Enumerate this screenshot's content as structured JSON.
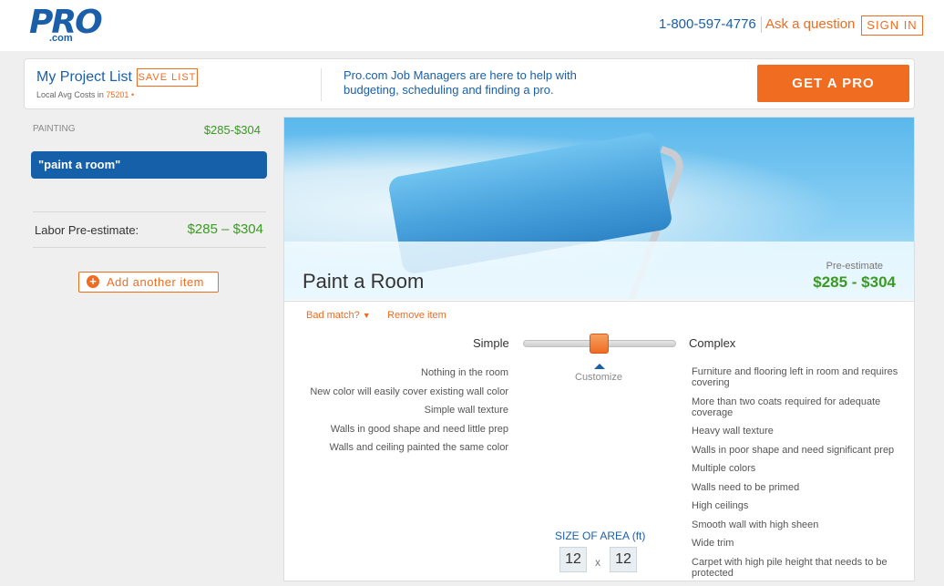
{
  "header": {
    "logo_text": "PRO",
    "logo_sub": ".com",
    "phone": "1-800-597-4776",
    "ask": "Ask a question",
    "signin": "SIGN IN"
  },
  "project_bar": {
    "title": "My Project List",
    "save_list": "SAVE LIST",
    "avg_label": "Local Avg Costs in",
    "zip": "75201",
    "message": "Pro.com Job Managers are here to help with budgeting, scheduling and finding a pro.",
    "get_pro": "GET A PRO"
  },
  "sidebar": {
    "category": "PAINTING",
    "category_price": "$285-$304",
    "item": "\"paint a room\"",
    "labor_label": "Labor Pre-estimate:",
    "labor_price": "$285 – $304",
    "add_item": "Add another item"
  },
  "detail": {
    "title": "Paint a Room",
    "pre_estimate_label": "Pre-estimate",
    "pre_estimate_price": "$285 - $304",
    "bad_match": "Bad match?",
    "remove": "Remove item",
    "slider": {
      "left_label": "Simple",
      "right_label": "Complex",
      "customize": "Customize",
      "position_fraction": 0.49
    },
    "simple_factors": [
      "Nothing in the room",
      "New color will easily cover existing wall color",
      "Simple wall texture",
      "Walls in good shape and need little prep",
      "Walls and ceiling painted the same color"
    ],
    "complex_factors": [
      "Furniture and flooring left in room and requires covering",
      "More than two coats required for adequate coverage",
      "Heavy wall texture",
      "Walls in poor shape and need significant prep",
      "Multiple colors",
      "Walls need to be primed",
      "High ceilings",
      "Smooth wall with high sheen",
      "Wide trim",
      "Carpet with high pile height that needs to be protected"
    ],
    "size": {
      "label": "SIZE OF AREA (ft)",
      "width": "12",
      "length": "12",
      "times": "x"
    }
  },
  "colors": {
    "brand_blue": "#1a5fa8",
    "accent_orange": "#ef6c21",
    "price_green": "#3a9a22"
  }
}
